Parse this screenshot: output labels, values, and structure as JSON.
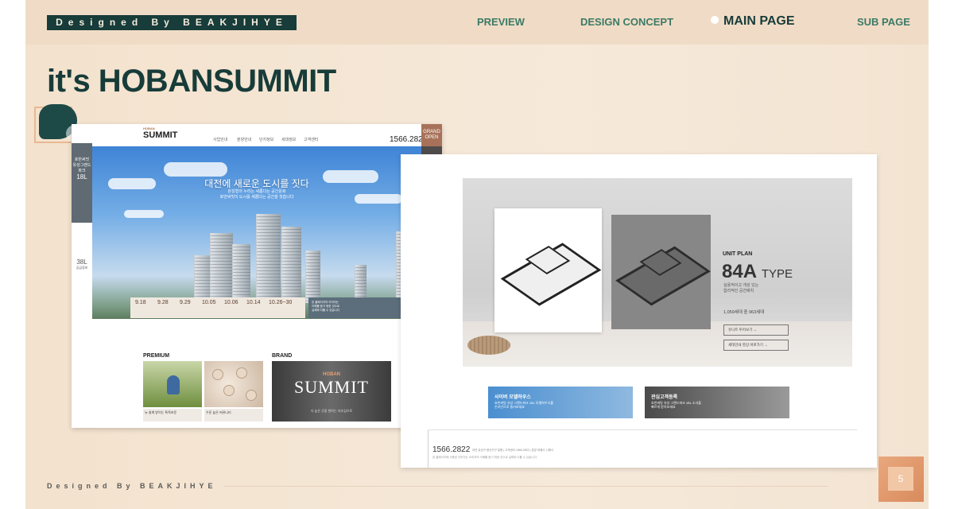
{
  "header": {
    "brand": "Designed By BEAKJIHYE",
    "nav": [
      "PREVIEW",
      "DESIGN CONCEPT",
      "MAIN PAGE",
      "SUB PAGE"
    ],
    "active_nav": "MAIN PAGE"
  },
  "title": "it's HOBANSUMMIT",
  "main_shot": {
    "logo_small": "HOBAN",
    "logo": "SUMMIT",
    "menu": [
      "사업안내",
      "분양안내",
      "단지정보",
      "세대정보",
      "고객센터"
    ],
    "phone": "1566.2822",
    "grand_open": [
      "GRAND",
      "OPEN"
    ],
    "left_badge": "18L",
    "left_badge2": "38L",
    "hero_title": "대전에 새로운 도시를 짓다",
    "hero_sub": [
      "완성형의 누리는 새롭다는 공간문화",
      "호반써밋이 도시를 새롭다는 공간을 짓습니다"
    ],
    "dates": [
      "9.18",
      "9.28",
      "9.29",
      "10.05",
      "10.06",
      "10.14",
      "10.26~30"
    ],
    "premium_label": "PREMIUM",
    "brand_label": "BRAND",
    "premium_caption_1": "뉴 설계 받이는 특목포운",
    "premium_caption_2": "수준 높은 커뮤니티",
    "brand_small": "HOBAN",
    "brand_name": "SUMMIT",
    "brand_tagline": "더 높은 곳을 향하는 자부심으로"
  },
  "sub_shot": {
    "unit_plan_label": "UNIT PLAN",
    "type_number": "84A",
    "type_word": "TYPE",
    "description": [
      "실용적이고 개성 있는",
      "합리적인 공간배치"
    ],
    "units": "1,059세대 중 963세대",
    "btn_1": "유니트 투어보기 →",
    "btn_2": "세대안내 영상 바로가기 →",
    "box1_title": "사이버 모델하우스",
    "box1_desc": [
      "호반써밋 유성 그랜드파크 1BL 모델하우스를",
      "온라인으로 둘러보세요"
    ],
    "box2_title": "관심고객등록",
    "box2_desc": [
      "호반써밋 유성 그랜드파크 1BL 소식을",
      "빠르게 받아보세요"
    ],
    "footer_phone": "1566.2822",
    "footer_fine": "대전 유성구 봉산지구 일원 | 고객센터 1566.2822 | 분양 대행사 시행사",
    "footer_fine2": "본 홈페이지에 사용된 이미지는 소비자의 이해를 돕기 위한 것으로 실제와 다를 수 있습니다."
  },
  "footer": {
    "text": "Designed By BEAKJIHYE",
    "page": "5"
  },
  "colors": {
    "accent_dark": "#173c39",
    "nav_green": "#3c7a66",
    "background": "#f3e2cd",
    "page_badge": "#e9a87e"
  },
  "icons": [
    "grand-open-badge",
    "calendar-icon",
    "map-icon",
    "home-icon",
    "search-icon",
    "speaker-icon"
  ]
}
